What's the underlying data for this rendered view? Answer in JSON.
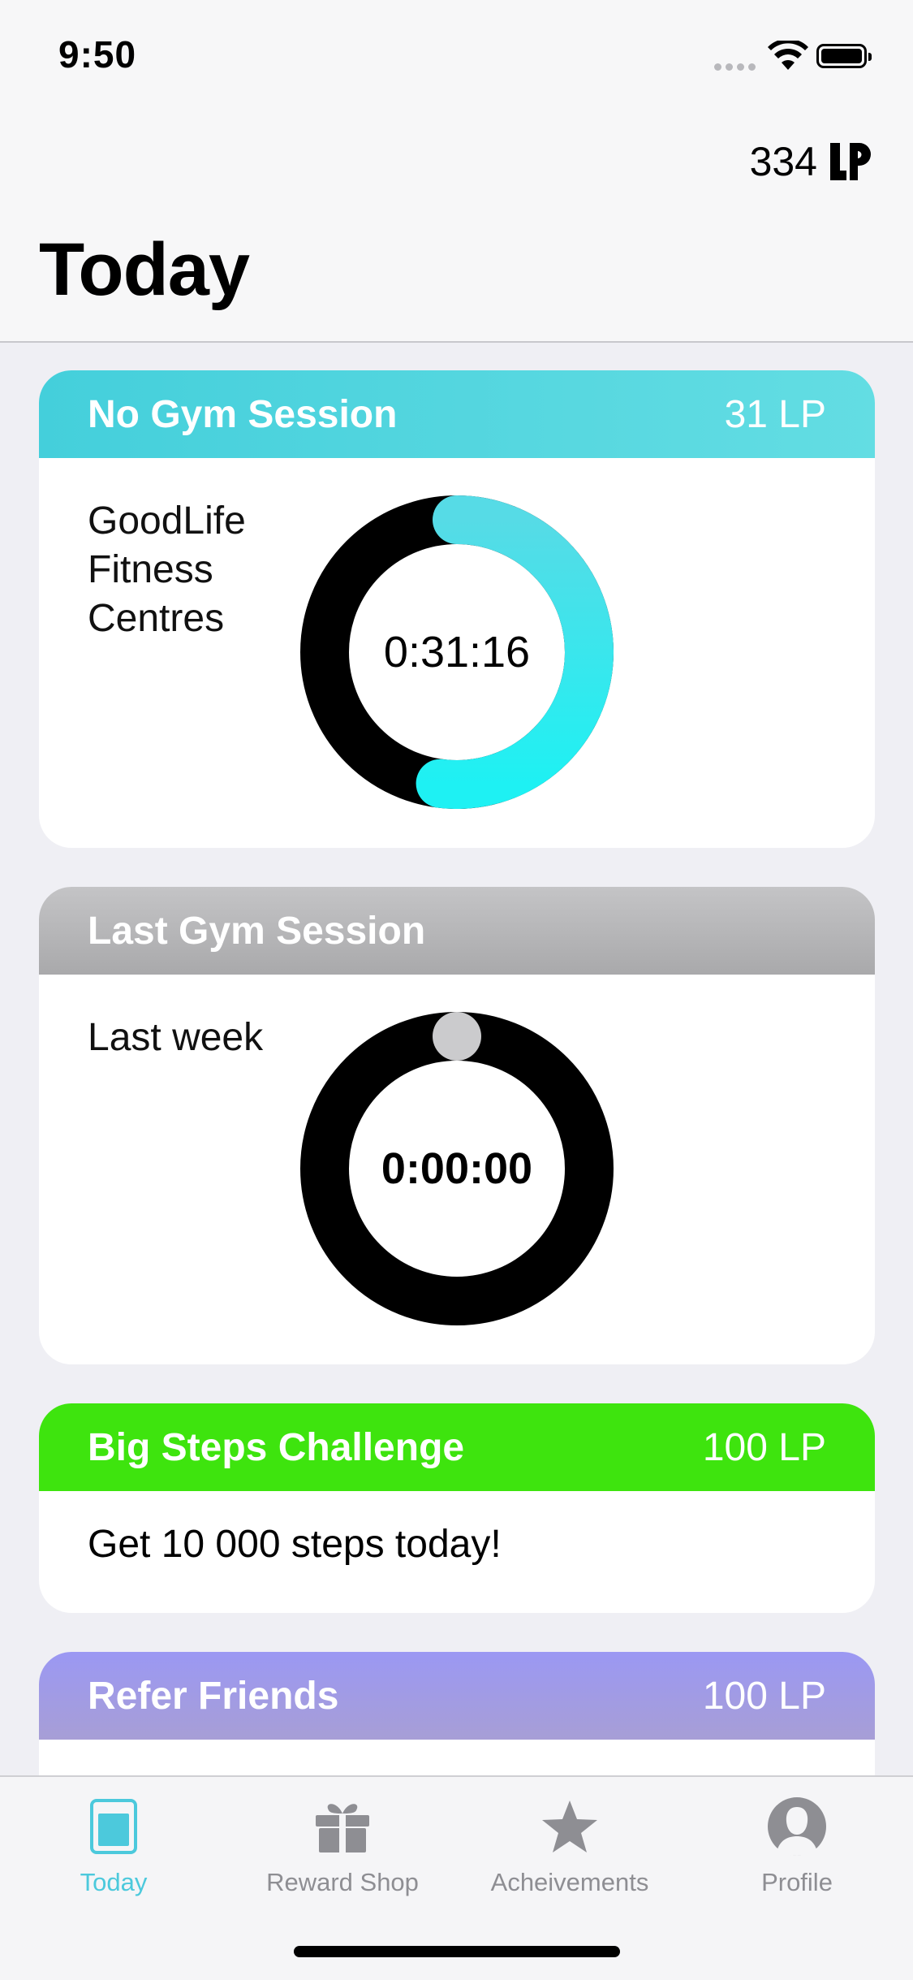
{
  "status_bar": {
    "time": "9:50"
  },
  "header": {
    "points_value": "334",
    "points_logo": "lp",
    "title": "Today"
  },
  "cards": [
    {
      "title": "No Gym Session",
      "lp": "31 LP",
      "location": "GoodLife\nFitness\nCentres",
      "timer": "0:31:16",
      "progress": 0.52,
      "colors": {
        "header": "#4ed6df",
        "ring_start": "#56dbe6",
        "ring_end": "#1ef1f3",
        "ring_track": "#000000"
      }
    },
    {
      "title": "Last Gym Session",
      "period": "Last week",
      "timer": "0:00:00",
      "progress": 0.0,
      "colors": {
        "header": "#b5b5b7",
        "ring_track": "#000000",
        "knob": "#cbcbcd"
      }
    },
    {
      "title": "Big Steps Challenge",
      "lp": "100 LP",
      "description": "Get 10 000 steps today!",
      "colors": {
        "header": "#3ee40e"
      }
    },
    {
      "title": "Refer Friends",
      "lp": "100 LP",
      "colors": {
        "header": "#a09ce6"
      }
    }
  ],
  "tabs": [
    {
      "label": "Today",
      "icon": "today-icon",
      "active": true
    },
    {
      "label": "Reward Shop",
      "icon": "gift-icon",
      "active": false
    },
    {
      "label": "Acheivements",
      "icon": "star-icon",
      "active": false
    },
    {
      "label": "Profile",
      "icon": "profile-icon",
      "active": false
    }
  ],
  "theme": {
    "accent": "#4cc9dc",
    "inactive": "#8e8e93"
  }
}
